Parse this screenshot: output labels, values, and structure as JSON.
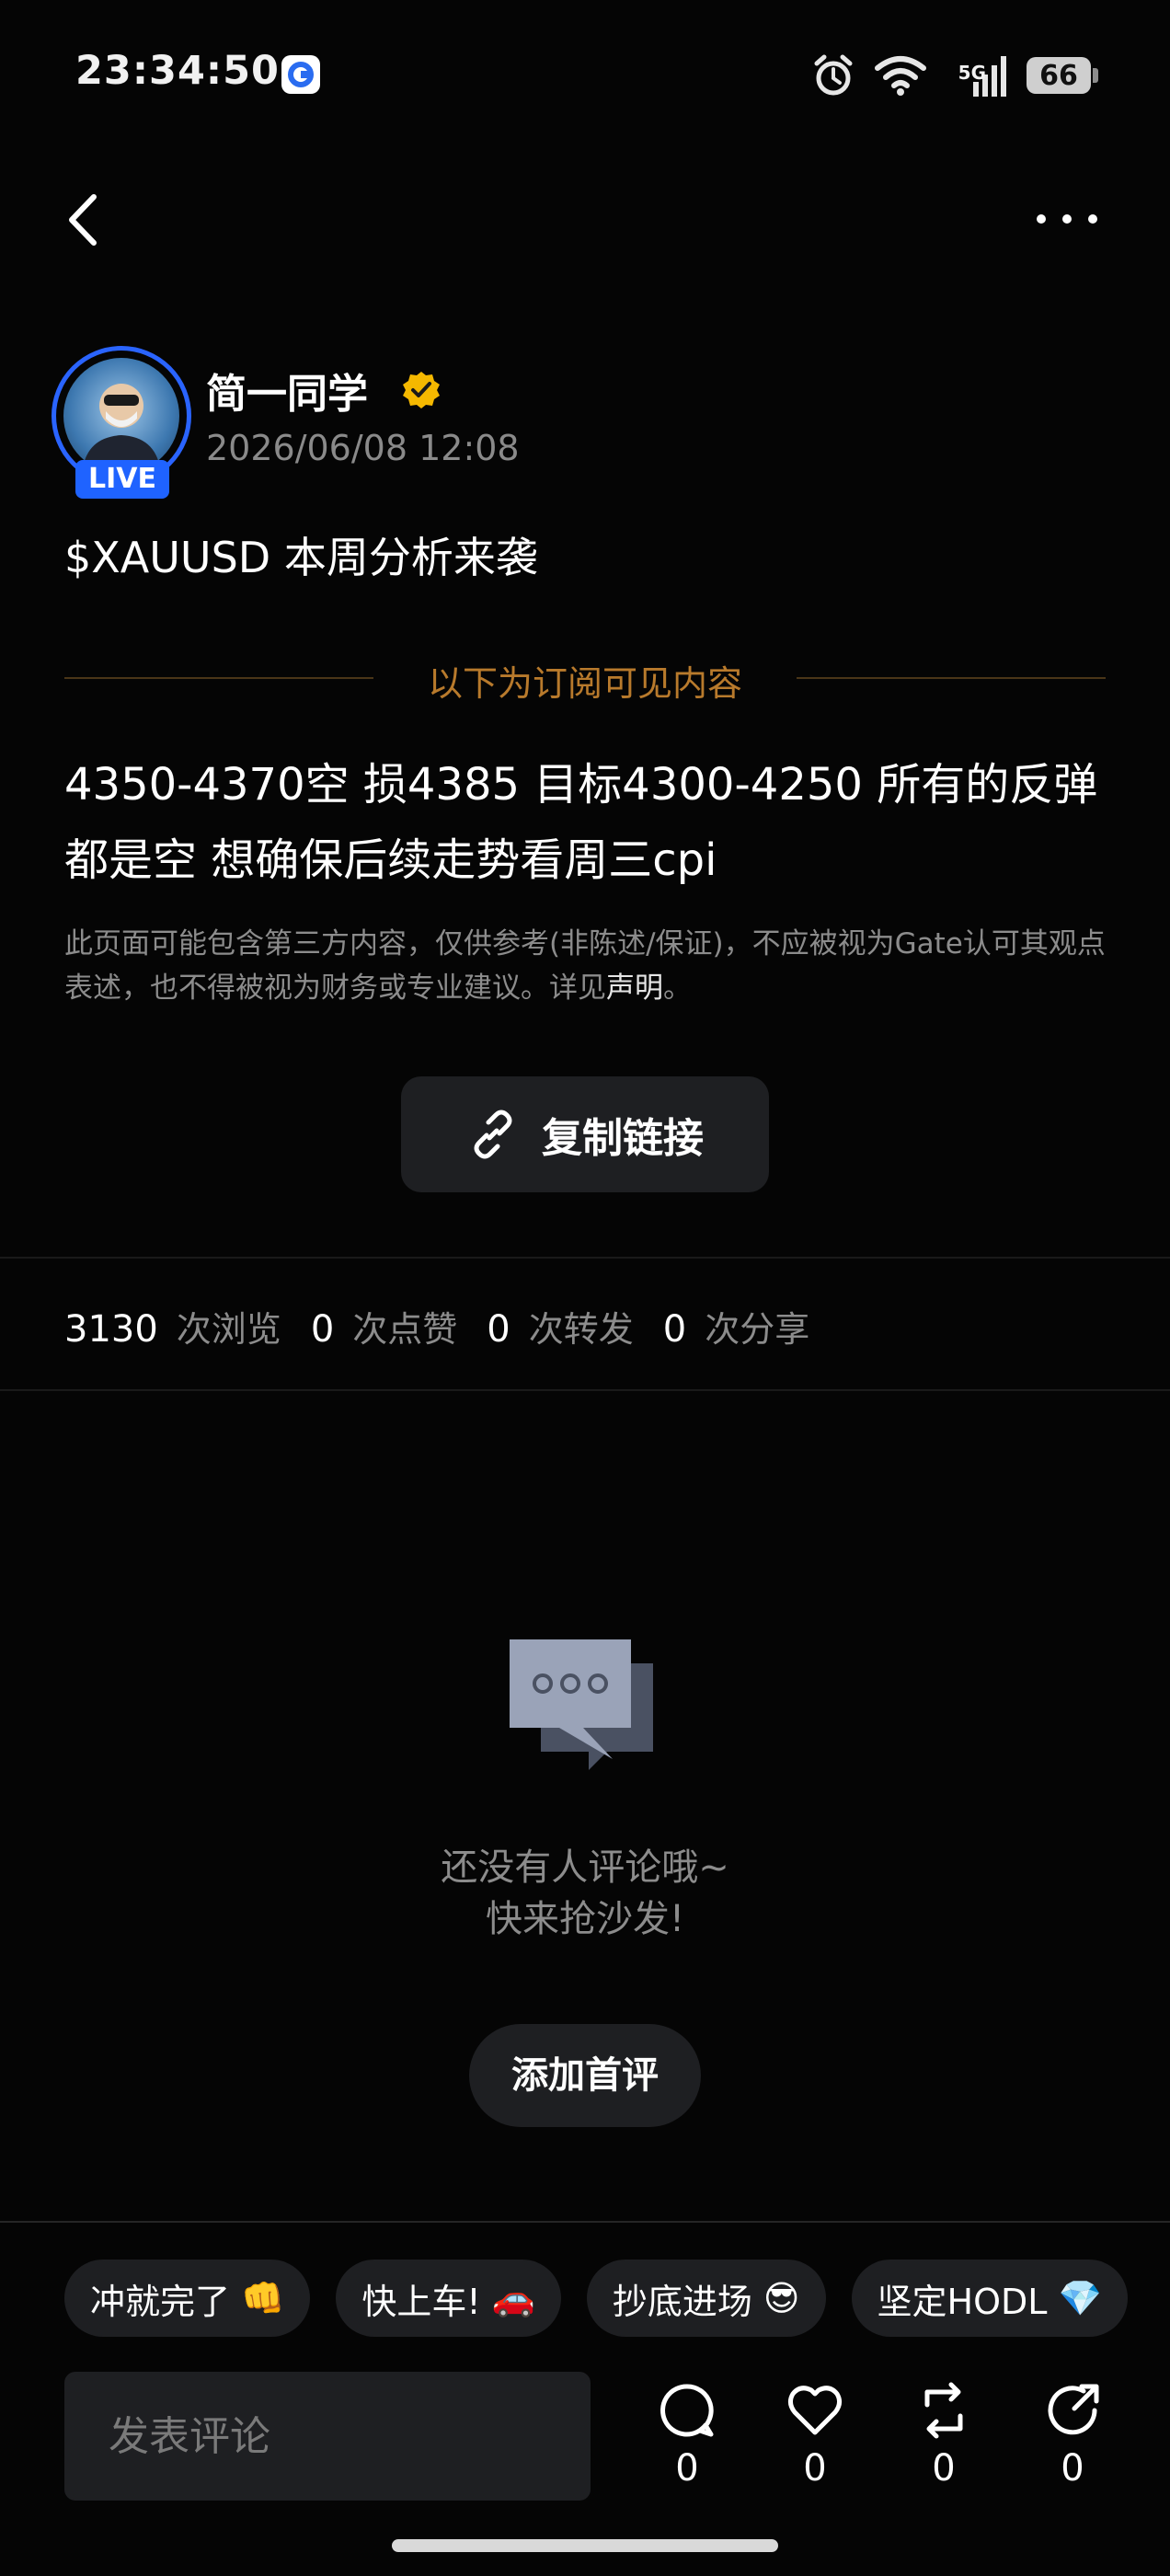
{
  "status_bar": {
    "time": "23:34:50",
    "network": "5G",
    "battery": "66"
  },
  "author": {
    "name": "简一同学",
    "timestamp": "2026/06/08 12:08",
    "live_badge": "LIVE"
  },
  "post": {
    "title": "$XAUUSD 本周分析来袭",
    "subscribe_divider": "以下为订阅可见内容",
    "body": "4350-4370空 损4385 目标4300-4250  所有的反弹都是空 想确保后续走势看周三cpi",
    "disclaimer_prefix": "此页面可能包含第三方内容，仅供参考(非陈述/保证)，不应被视为Gate认可其观点表述，也不得被视为财务或专业建议。详见",
    "disclaimer_link": "声明",
    "disclaimer_suffix": "。"
  },
  "copy_link_label": "复制链接",
  "stats": [
    {
      "value": "3130",
      "label": "次浏览"
    },
    {
      "value": "0",
      "label": "次点赞"
    },
    {
      "value": "0",
      "label": "次转发"
    },
    {
      "value": "0",
      "label": "次分享"
    }
  ],
  "empty_state": {
    "line1": "还没有人评论哦~",
    "line2": "快来抢沙发!",
    "button": "添加首评"
  },
  "quick_replies": [
    {
      "text": "冲就完了",
      "emoji": "👊"
    },
    {
      "text": "快上车!",
      "emoji": "🚗"
    },
    {
      "text": "抄底进场",
      "emoji": "😎"
    },
    {
      "text": "坚定HODL",
      "emoji": "💎"
    }
  ],
  "comment_input": {
    "placeholder": "发表评论"
  },
  "actions": [
    {
      "icon": "comment-icon",
      "count": "0"
    },
    {
      "icon": "heart-icon",
      "count": "0"
    },
    {
      "icon": "repost-icon",
      "count": "0"
    },
    {
      "icon": "share-icon",
      "count": "0"
    }
  ],
  "colors": {
    "background": "#050505",
    "accent_gold": "#b87a2c",
    "live_blue": "#1f63ff",
    "verified_gold": "#f5b800"
  }
}
